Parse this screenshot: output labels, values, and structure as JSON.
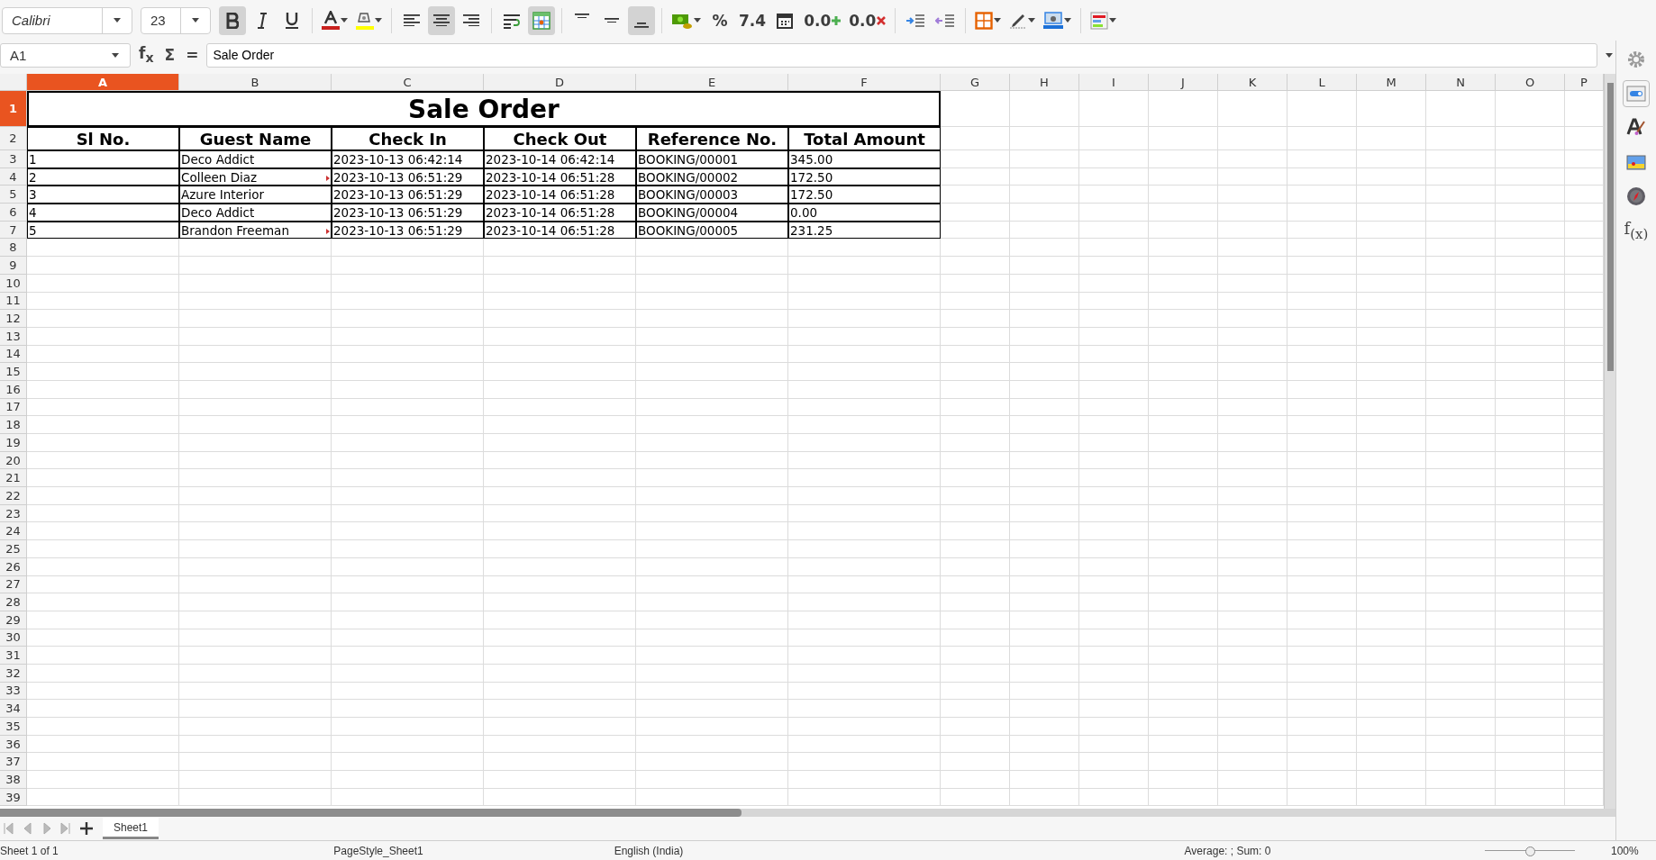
{
  "toolbar": {
    "font_name": "Calibri",
    "font_size": "23",
    "buttons": [
      {
        "kind": "bold",
        "active": true
      },
      {
        "kind": "italic",
        "active": false
      },
      {
        "kind": "underline",
        "active": false
      },
      {
        "kind": "separator"
      },
      {
        "kind": "font-color",
        "active": false
      },
      {
        "kind": "highlight",
        "active": false
      },
      {
        "kind": "separator"
      },
      {
        "kind": "align-left",
        "active": false
      },
      {
        "kind": "align-center",
        "active": true
      },
      {
        "kind": "align-right",
        "active": false
      },
      {
        "kind": "separator"
      },
      {
        "kind": "wrap",
        "active": false
      },
      {
        "kind": "merge",
        "active": true
      },
      {
        "kind": "separator"
      },
      {
        "kind": "align-top",
        "active": false
      },
      {
        "kind": "align-middle",
        "active": false
      },
      {
        "kind": "align-bottom",
        "active": true
      },
      {
        "kind": "separator"
      },
      {
        "kind": "currency",
        "active": false
      },
      {
        "kind": "text",
        "label": "%",
        "active": false
      },
      {
        "kind": "text",
        "label": "7.4",
        "active": false
      },
      {
        "kind": "date",
        "active": false
      },
      {
        "kind": "add-decimal",
        "label": "0.0",
        "active": false
      },
      {
        "kind": "delete-decimal",
        "label": "0.0",
        "active": false
      },
      {
        "kind": "separator"
      },
      {
        "kind": "indent",
        "active": false
      },
      {
        "kind": "outdent",
        "active": false
      },
      {
        "kind": "separator"
      },
      {
        "kind": "borders",
        "active": false
      },
      {
        "kind": "border-style",
        "active": false
      },
      {
        "kind": "border-color",
        "active": false
      },
      {
        "kind": "separator"
      },
      {
        "kind": "conditional",
        "active": false
      }
    ]
  },
  "formula_bar": {
    "name_box": "A1",
    "buttons": [
      "f$_{x}$",
      "Σ",
      "="
    ],
    "value": "Sale Order"
  },
  "sheet": {
    "columns": [
      {
        "label": "A",
        "selected": true
      },
      {
        "label": "B",
        "selected": false
      },
      {
        "label": "C",
        "selected": false
      },
      {
        "label": "D",
        "selected": false
      },
      {
        "label": "E",
        "selected": false
      },
      {
        "label": "F",
        "selected": false
      },
      {
        "label": "G",
        "selected": false
      },
      {
        "label": "H",
        "selected": false
      },
      {
        "label": "I",
        "selected": false
      },
      {
        "label": "J",
        "selected": false
      },
      {
        "label": "K",
        "selected": false
      },
      {
        "label": "L",
        "selected": false
      },
      {
        "label": "M",
        "selected": false
      },
      {
        "label": "N",
        "selected": false
      },
      {
        "label": "O",
        "selected": false
      },
      {
        "label": "P",
        "selected": false
      }
    ],
    "row_headers": [
      {
        "label": "1",
        "selected": true
      },
      {
        "label": "2",
        "selected": false
      },
      {
        "label": "3",
        "selected": false
      },
      {
        "label": "4",
        "selected": false
      },
      {
        "label": "5",
        "selected": false
      },
      {
        "label": "6",
        "selected": false
      },
      {
        "label": "7",
        "selected": false
      },
      {
        "label": "8",
        "selected": false
      },
      {
        "label": "9",
        "selected": false
      },
      {
        "label": "10",
        "selected": false
      },
      {
        "label": "11",
        "selected": false
      },
      {
        "label": "12",
        "selected": false
      },
      {
        "label": "13",
        "selected": false
      },
      {
        "label": "14",
        "selected": false
      },
      {
        "label": "15",
        "selected": false
      },
      {
        "label": "16",
        "selected": false
      },
      {
        "label": "17",
        "selected": false
      },
      {
        "label": "18",
        "selected": false
      },
      {
        "label": "19",
        "selected": false
      },
      {
        "label": "20",
        "selected": false
      },
      {
        "label": "21",
        "selected": false
      },
      {
        "label": "22",
        "selected": false
      },
      {
        "label": "23",
        "selected": false
      },
      {
        "label": "24",
        "selected": false
      },
      {
        "label": "25",
        "selected": false
      },
      {
        "label": "26",
        "selected": false
      },
      {
        "label": "27",
        "selected": false
      },
      {
        "label": "28",
        "selected": false
      },
      {
        "label": "29",
        "selected": false
      },
      {
        "label": "30",
        "selected": false
      },
      {
        "label": "31",
        "selected": false
      },
      {
        "label": "32",
        "selected": false
      },
      {
        "label": "33",
        "selected": false
      },
      {
        "label": "34",
        "selected": false
      },
      {
        "label": "35",
        "selected": false
      },
      {
        "label": "36",
        "selected": false
      },
      {
        "label": "37",
        "selected": false
      },
      {
        "label": "38",
        "selected": false
      },
      {
        "label": "39",
        "selected": false
      }
    ],
    "title": "Sale Order",
    "headers": [
      "Sl No.",
      "Guest Name",
      "Check In",
      "Check Out",
      "Reference No.",
      "Total Amount"
    ],
    "rows": [
      {
        "cells": [
          "1",
          "Deco Addict",
          "2023-10-13 06:42:14",
          "2023-10-14 06:42:14",
          "BOOKING/00001",
          "345.00"
        ],
        "overflow_marker": false
      },
      {
        "cells": [
          "2",
          "Colleen Diaz",
          "2023-10-13 06:51:29",
          "2023-10-14 06:51:28",
          "BOOKING/00002",
          "172.50"
        ],
        "overflow_marker": true
      },
      {
        "cells": [
          "3",
          "Azure Interior",
          "2023-10-13 06:51:29",
          "2023-10-14 06:51:28",
          "BOOKING/00003",
          "172.50"
        ],
        "overflow_marker": false
      },
      {
        "cells": [
          "4",
          "Deco Addict",
          "2023-10-13 06:51:29",
          "2023-10-14 06:51:28",
          "BOOKING/00004",
          "0.00"
        ],
        "overflow_marker": false
      },
      {
        "cells": [
          "5",
          "Brandon Freeman",
          "2023-10-13 06:51:29",
          "2023-10-14 06:51:28",
          "BOOKING/00005",
          "231.25"
        ],
        "overflow_marker": true
      }
    ]
  },
  "sheet_tabs": [
    {
      "label": "Sheet1",
      "selected": true
    }
  ],
  "sidebar": [
    {
      "kind": "settings",
      "selected": false
    },
    {
      "kind": "properties",
      "selected": true
    },
    {
      "kind": "styles",
      "selected": false
    },
    {
      "kind": "gallery",
      "selected": false
    },
    {
      "kind": "navigator",
      "selected": false
    },
    {
      "kind": "functions",
      "label": "f$_{(x)}$",
      "selected": false
    }
  ],
  "status_bar": {
    "sheet": "Sheet 1 of 1",
    "page_style": "PageStyle_Sheet1",
    "language": "English (India)",
    "summary": "Average: ; Sum: 0",
    "zoom": {
      "level": 0.5
    },
    "zoom_text": "100%"
  }
}
